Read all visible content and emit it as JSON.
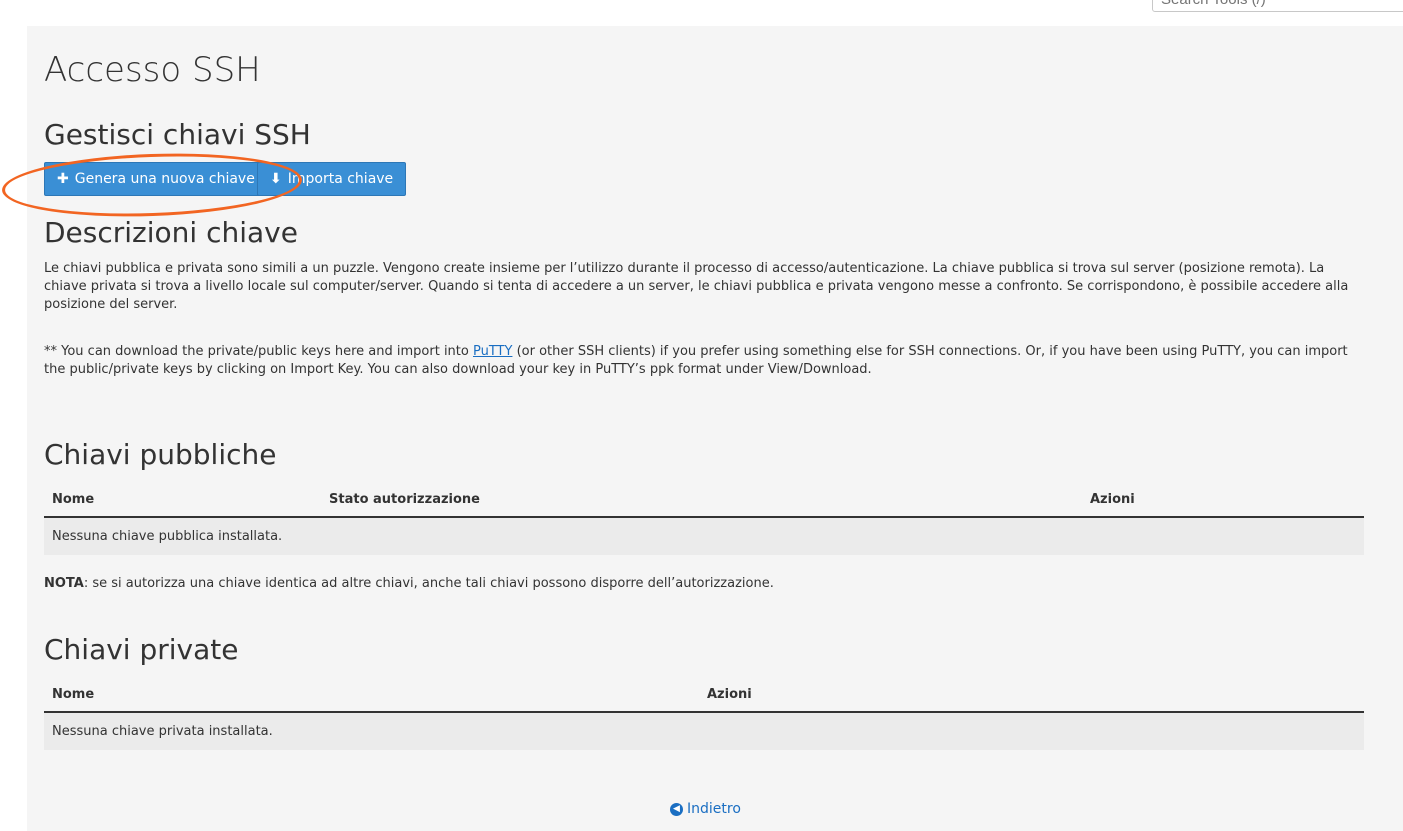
{
  "search": {
    "placeholder": "Search Tools (/)"
  },
  "page": {
    "title": "Accesso SSH"
  },
  "manage": {
    "heading": "Gestisci chiavi SSH",
    "generate_label": "Genera una nuova chiave",
    "import_label": "Importa chiave",
    "generate_icon": "plus-icon",
    "import_icon": "import-icon"
  },
  "descriptions": {
    "heading": "Descrizioni chiave",
    "body": "Le chiavi pubblica e privata sono simili a un puzzle. Vengono create insieme per l’utilizzo durante il processo di accesso/autenticazione. La chiave pubblica si trova sul server (posizione remota). La chiave privata si trova a livello locale sul computer/server. Quando si tenta di accedere a un server, le chiavi pubblica e privata vengono messe a confronto. Se corrispondono, è possibile accedere alla posizione del server.",
    "putty_before": "** You can download the private/public keys here and import into ",
    "putty_link": "PuTTY",
    "putty_after": " (or other SSH clients) if you prefer using something else for SSH connections. Or, if you have been using PuTTY, you can import the public/private keys by clicking on Import Key. You can also download your key in PuTTY’s ppk format under View/Download."
  },
  "public_keys": {
    "heading": "Chiavi pubbliche",
    "columns": [
      "Nome",
      "Stato autorizzazione",
      "Azioni"
    ],
    "empty_message": "Nessuna chiave pubblica installata."
  },
  "note": {
    "label": "NOTA",
    "text": ": se si autorizza una chiave identica ad altre chiavi, anche tali chiavi possono disporre dell’autorizzazione."
  },
  "private_keys": {
    "heading": "Chiavi private",
    "columns": [
      "Nome",
      "Azioni"
    ],
    "empty_message": "Nessuna chiave privata installata."
  },
  "back": {
    "label": "Indietro",
    "icon": "arrow-left-circle-icon"
  },
  "colors": {
    "button_bg": "#3a8fd5",
    "link": "#1a6ec2",
    "annotation": "#f26522",
    "content_bg": "#f5f5f5"
  }
}
